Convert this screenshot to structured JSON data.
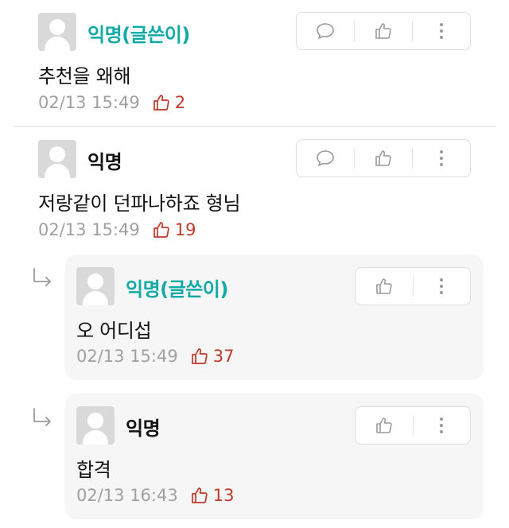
{
  "comments": [
    {
      "author": "익명(글쓴이)",
      "text": "추천을 왜해",
      "time": "02/13 15:49",
      "likes": "2"
    },
    {
      "author": "익명",
      "text": "저랑같이 던파나하죠 형님",
      "time": "02/13 15:49",
      "likes": "19"
    }
  ],
  "replies": [
    {
      "author": "익명(글쓴이)",
      "text": "오 어디섭",
      "time": "02/13 15:49",
      "likes": "37"
    },
    {
      "author": "익명",
      "text": "합격",
      "time": "02/13 16:43",
      "likes": "13"
    }
  ],
  "icons": [
    "comment-icon",
    "thumbs-up-icon",
    "more-vertical-icon",
    "reply-arrow-icon"
  ],
  "colors": {
    "op_name": "#12a9a6",
    "like": "#c0392b",
    "meta": "#a0a0a0",
    "reply_bg": "#f6f6f6"
  }
}
